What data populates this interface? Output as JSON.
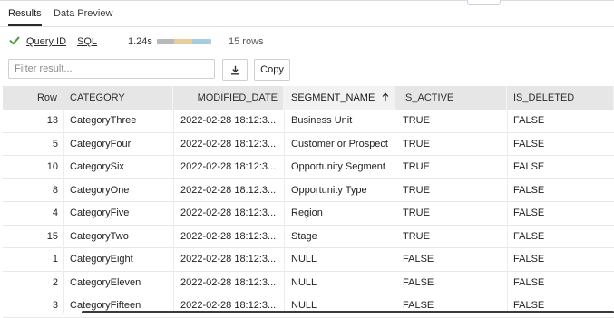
{
  "tabs": [
    {
      "label": "Results",
      "active": true
    },
    {
      "label": "Data Preview",
      "active": false
    }
  ],
  "meta": {
    "query_id_label": "Query ID",
    "sql_label": "SQL",
    "duration": "1.24s",
    "rows_label": "15 rows",
    "timing_bar_colors": [
      "#b9b9b9",
      "#e7cf9c",
      "#a9cde0"
    ]
  },
  "toolbar": {
    "filter_placeholder": "Filter result...",
    "download_icon": "download-icon",
    "copy_label": "Copy"
  },
  "columns": [
    {
      "key": "row",
      "label": "Row"
    },
    {
      "key": "category",
      "label": "CATEGORY"
    },
    {
      "key": "modified_date",
      "label": "MODIFIED_DATE"
    },
    {
      "key": "segment_name",
      "label": "SEGMENT_NAME",
      "sort": "ascending",
      "sort_icon": "arrow-up-icon"
    },
    {
      "key": "is_active",
      "label": "IS_ACTIVE"
    },
    {
      "key": "is_deleted",
      "label": "IS_DELETED"
    }
  ],
  "rows": [
    [
      "13",
      "CategoryThree",
      "2022-02-28 18:12:3...",
      "Business Unit",
      "TRUE",
      "FALSE"
    ],
    [
      "5",
      "CategoryFour",
      "2022-02-28 18:12:3...",
      "Customer or Prospect",
      "TRUE",
      "FALSE"
    ],
    [
      "10",
      "CategorySix",
      "2022-02-28 18:12:3...",
      "Opportunity Segment",
      "TRUE",
      "FALSE"
    ],
    [
      "8",
      "CategoryOne",
      "2022-02-28 18:12:3...",
      "Opportunity Type",
      "TRUE",
      "FALSE"
    ],
    [
      "4",
      "CategoryFive",
      "2022-02-28 18:12:3...",
      "Region",
      "TRUE",
      "FALSE"
    ],
    [
      "15",
      "CategoryTwo",
      "2022-02-28 18:12:3...",
      "Stage",
      "TRUE",
      "FALSE"
    ],
    [
      "1",
      "CategoryEight",
      "2022-02-28 18:12:3...",
      "NULL",
      "FALSE",
      "FALSE"
    ],
    [
      "2",
      "CategoryEleven",
      "2022-02-28 18:12:3...",
      "NULL",
      "FALSE",
      "FALSE"
    ],
    [
      "3",
      "CategoryFifteen",
      "2022-02-28 18:12:3...",
      "NULL",
      "FALSE",
      "FALSE"
    ]
  ],
  "colors": {
    "success": "#4a9a3a",
    "header_bg": "#e6e6e6"
  }
}
